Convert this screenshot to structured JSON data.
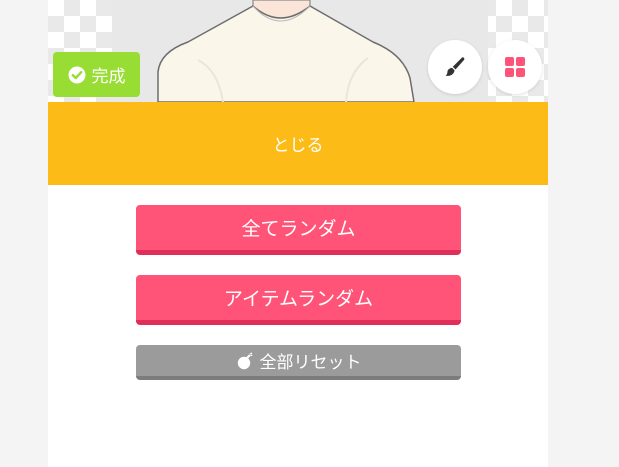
{
  "preview": {
    "done_label": "完成",
    "done_icon": "check-icon",
    "brush_icon": "brush-icon",
    "grid_icon": "grid-icon",
    "accent_green": "#97dd33",
    "accent_pink": "#ff5478"
  },
  "close_bar": {
    "label": "とじる",
    "color": "#fdbb17"
  },
  "actions": {
    "random_all_label": "全てランダム",
    "random_item_label": "アイテムランダム",
    "reset_label": "全部リセット",
    "reset_icon": "bomb-icon",
    "button_color": "#ff5478",
    "reset_color": "#9b9b9b"
  }
}
